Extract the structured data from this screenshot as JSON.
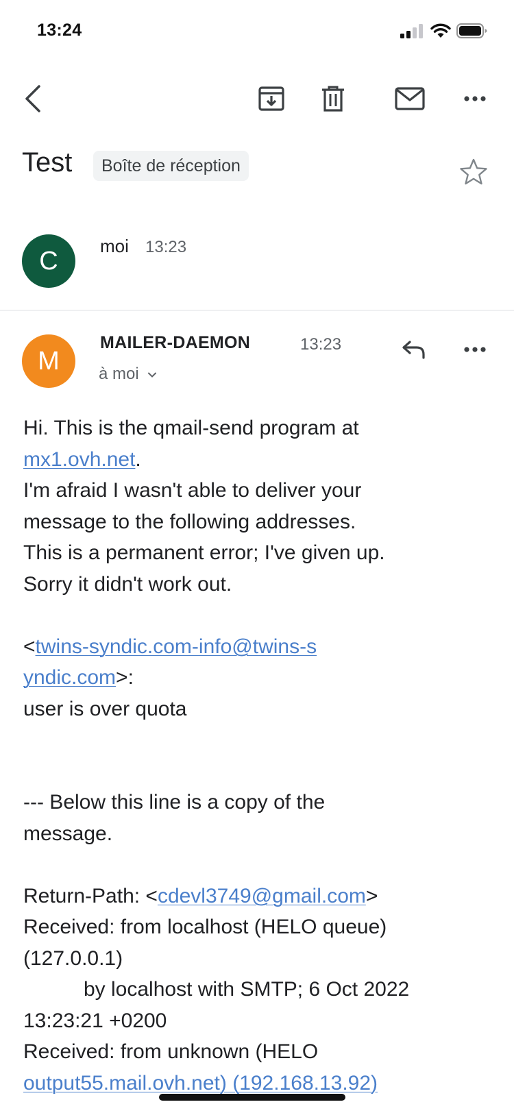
{
  "status_bar": {
    "time": "13:24"
  },
  "thread": {
    "subject": "Test",
    "label": "Boîte de réception"
  },
  "message1": {
    "avatar_letter": "C",
    "avatar_color": "#0f5a3e",
    "sender": "moi",
    "time": "13:23"
  },
  "message2": {
    "avatar_letter": "M",
    "avatar_color": "#f28a1e",
    "sender": "MAILER-DAEMON",
    "time": "13:23",
    "recipient": "à moi",
    "body": {
      "l1": "Hi. This is the qmail-send program at",
      "link_mx": "mx1.ovh.net",
      "l2_after": ".",
      "l3": "I'm afraid I wasn't able to deliver your",
      "l4": "message to the following addresses.",
      "l5": "This is a permanent error; I've given up.",
      "l6": "Sorry it didn't work out.",
      "addr_open": "<",
      "addr_link_a": "twins-syndic.com-info@twins-s",
      "addr_link_b": "yndic.com",
      "addr_close": ">:",
      "quota": "user is over quota",
      "below_a": "--- Below this line is a copy of the",
      "below_b": "message.",
      "rp_label": "Return-Path: <",
      "rp_link": "cdevl3749@gmail.com",
      "rp_close": ">",
      "rcv1_a": "Received: from localhost (HELO queue)",
      "rcv1_b": "(127.0.0.1)",
      "rcv1_c": "by localhost with SMTP; 6 Oct 2022",
      "rcv1_d": "13:23:21 +0200",
      "rcv2_a": "Received: from unknown (HELO",
      "rcv2_link": "output55.mail.ovh.net",
      "rcv2_after": ") (192.168.13.92)"
    }
  },
  "colors": {
    "link": "#4a7fcb",
    "chip_bg": "#f1f3f4"
  }
}
